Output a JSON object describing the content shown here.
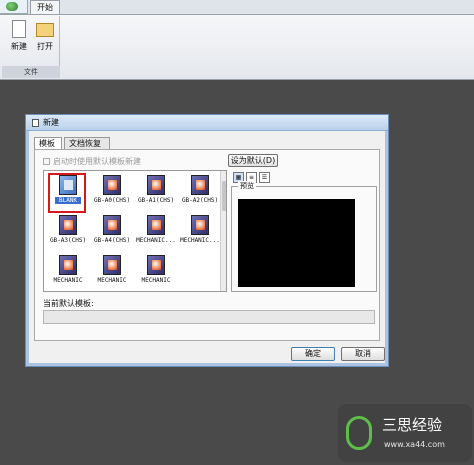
{
  "ribbon": {
    "tab": "开始",
    "buttons": [
      {
        "label": "新建",
        "icon": "new-file-icon"
      },
      {
        "label": "打开",
        "icon": "open-folder-icon"
      }
    ],
    "group_label": "文件"
  },
  "dialog": {
    "title": "新建",
    "tabs": [
      "模板",
      "文档恢复"
    ],
    "startup_checkbox": "启动时使用默认模板新建",
    "set_default_button": "设为默认(D)",
    "view_buttons": [
      "large-icons-view",
      "list-view",
      "details-view"
    ],
    "templates": [
      {
        "name": "BLANK",
        "selected": true
      },
      {
        "name": "GB-A0(CHS)"
      },
      {
        "name": "GB-A1(CHS)"
      },
      {
        "name": "GB-A2(CHS)"
      },
      {
        "name": "GB-A3(CHS)"
      },
      {
        "name": "GB-A4(CHS)"
      },
      {
        "name": "MECHANIC..."
      },
      {
        "name": "MECHANIC..."
      },
      {
        "name": "MECHANIC"
      },
      {
        "name": "MECHANIC"
      },
      {
        "name": "MECHANIC"
      }
    ],
    "preview_label": "预览",
    "current_default_label": "当前默认模板:",
    "current_default_value": "",
    "ok_button": "确定",
    "cancel_button": "取消"
  },
  "watermark": {
    "title": "三思经验",
    "url": "www.xa44.com"
  },
  "colors": {
    "workspace": "#4a4a4a",
    "selection_highlight": "#d41a1a",
    "preview_background": "#000000"
  }
}
